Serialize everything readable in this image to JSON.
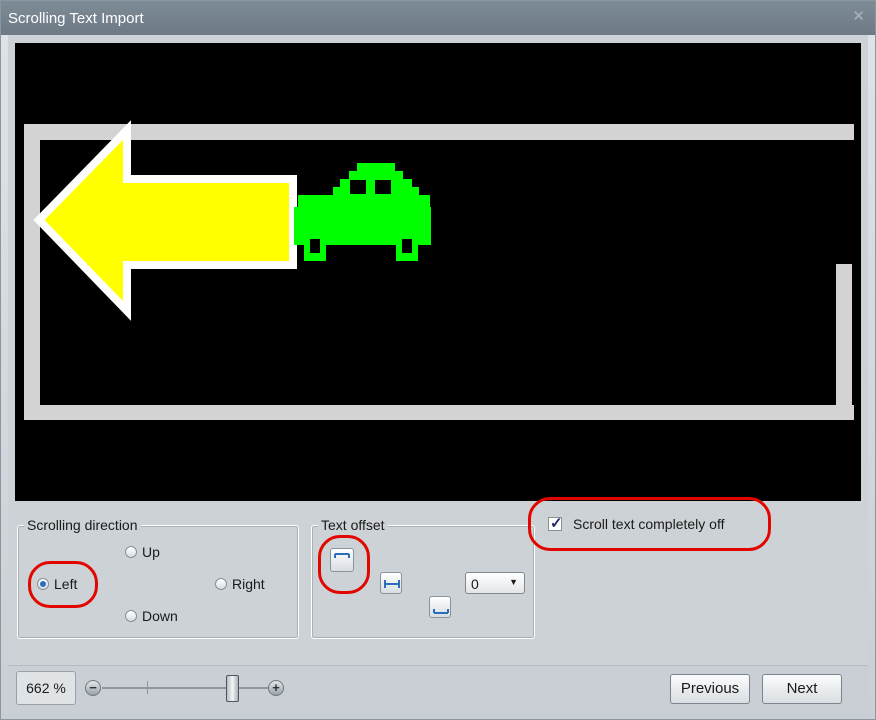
{
  "window": {
    "title": "Scrolling Text Import",
    "close_icon": "close-icon"
  },
  "preview": {
    "background": "#000000",
    "frame_color": "#d3d3d3",
    "arrow_color": "#ffff00",
    "arrow_outline": "#ffffff",
    "car_color": "#00ff00"
  },
  "scrolling_direction": {
    "label": "Scrolling direction",
    "options": {
      "up": "Up",
      "left": "Left",
      "right": "Right",
      "down": "Down"
    },
    "selected": "Left"
  },
  "text_offset": {
    "label": "Text offset",
    "buttons": [
      "align-top-icon",
      "align-middle-icon",
      "align-bottom-icon"
    ],
    "selected": "align-top-icon",
    "value": "0"
  },
  "scroll_off": {
    "label": "Scroll text completely off",
    "checked": true
  },
  "highlight_color": "#e10600",
  "zoom": {
    "text": "662 %",
    "minus": "−",
    "plus": "+",
    "level": 0.82
  },
  "footer": {
    "previous": "Previous",
    "next": "Next"
  }
}
